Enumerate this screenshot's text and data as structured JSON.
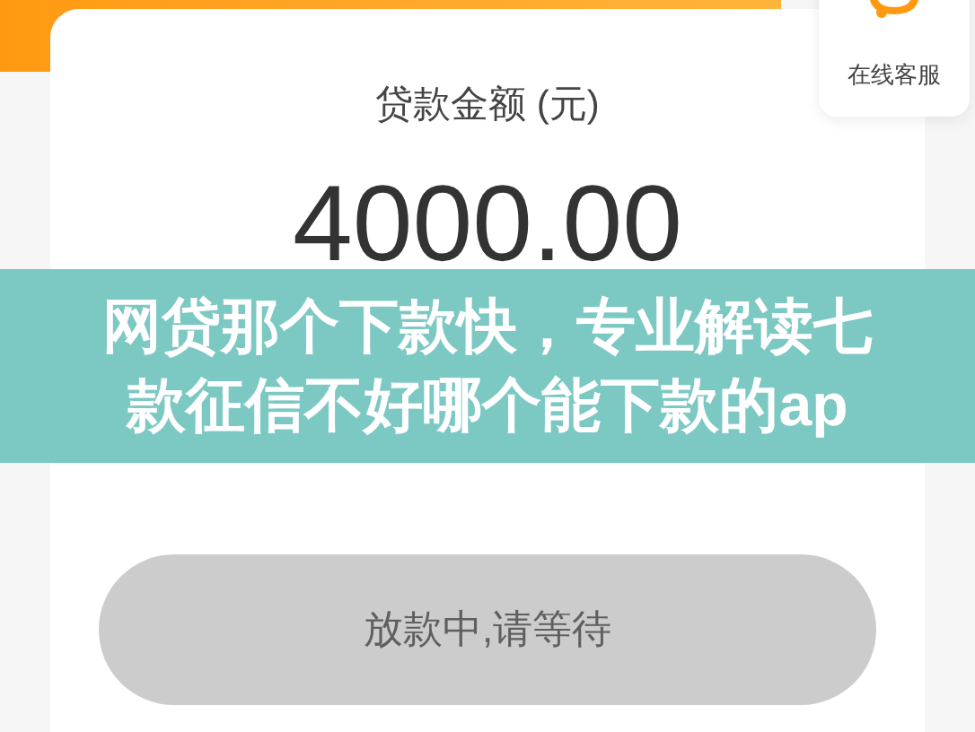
{
  "customer_service": {
    "label": "在线客服"
  },
  "loan_card": {
    "title": "贷款金额 (元)",
    "amount": "4000.00"
  },
  "banner": {
    "title": "网贷那个下款快，专业解读七款征信不好哪个能下款的ap"
  },
  "action_button": {
    "label": "放款中,请等待",
    "disabled": true
  }
}
